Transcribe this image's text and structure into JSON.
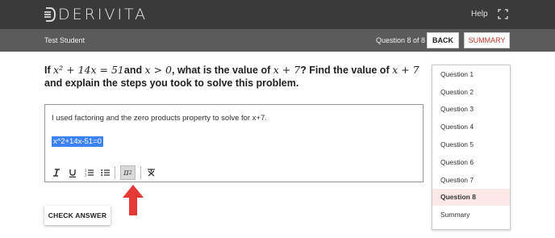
{
  "app": {
    "logo_text": "DERIVITA",
    "help_label": "Help"
  },
  "subheader": {
    "student_name": "Test Student",
    "question_counter": "Question 8 of 8",
    "back_label": "BACK",
    "summary_label": "SUMMARY"
  },
  "question": {
    "t1": "If ",
    "m1": "x² + 14x = 51",
    "t2": "and ",
    "m2": "x > 0",
    "t3": ", what is the value of ",
    "m3": "x + 7",
    "t4": "? Find the value of ",
    "m4": "x + 7",
    "t5": " and explain the steps you took to solve this problem."
  },
  "editor": {
    "answer_text": "I used factoring and the zero products property to solve for x+7.",
    "selected_text": "x^2+14x-51=0",
    "toolbar": [
      "italic-icon",
      "underline-icon",
      "ordered-list-icon",
      "bullet-list-icon",
      "math-pi-icon",
      "clear-format-icon"
    ]
  },
  "accent_color": "#e53935",
  "check_answer_label": "CHECK ANSWER",
  "question_nav": {
    "items": [
      "Question 1",
      "Question 2",
      "Question 3",
      "Question 4",
      "Question 5",
      "Question 6",
      "Question 7",
      "Question 8",
      "Summary"
    ],
    "active_index": 7
  }
}
